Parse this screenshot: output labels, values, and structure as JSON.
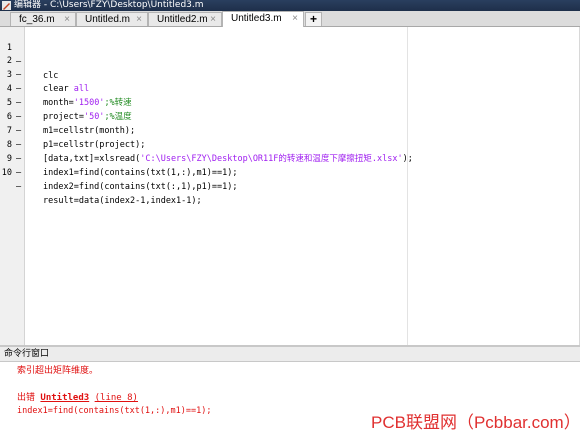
{
  "window": {
    "title": "编辑器 - C:\\Users\\FZY\\Desktop\\Untitled3.m"
  },
  "tabs": [
    {
      "label": "fc_36.m",
      "close": "×"
    },
    {
      "label": "Untitled.m",
      "close": "×"
    },
    {
      "label": "Untitled2.m",
      "close": "×"
    },
    {
      "label": "Untitled3.m",
      "close": "×",
      "active": true
    }
  ],
  "add_tab_label": "+",
  "editor": {
    "lines": [
      {
        "num": "1",
        "dash": "–",
        "code": "clc"
      },
      {
        "num": "2",
        "dash": "–",
        "code": "clear ",
        "str": "all"
      },
      {
        "num": "3",
        "dash": "–",
        "code": "month=",
        "str": "'1500'",
        "cmt": ";%转速"
      },
      {
        "num": "4",
        "dash": "–",
        "code": "project=",
        "str": "'50'",
        "cmt": ";%温度"
      },
      {
        "num": "5",
        "dash": "–",
        "code": "m1=cellstr(month);"
      },
      {
        "num": "6",
        "dash": "–",
        "code": "p1=cellstr(project);"
      },
      {
        "num": "7",
        "dash": "–",
        "code": "[data,txt]=xlsread(",
        "str": "'C:\\Users\\FZY\\Desktop\\OR11F的转速和温度下摩擦扭矩.xlsx'",
        "tail": ");"
      },
      {
        "num": "8",
        "dash": "–",
        "code": "index1=find(contains(txt(1,:),m1)==1);"
      },
      {
        "num": "9",
        "dash": "–",
        "code": "index2=find(contains(txt(:,1),p1)==1);"
      },
      {
        "num": "10",
        "dash": "–",
        "code": "result=data(index2-1,index1-1);"
      }
    ]
  },
  "command_window": {
    "title": "命令行窗口",
    "error_message": "索引超出矩阵维度。",
    "error_prefix": "出错 ",
    "error_file": "Untitled3",
    "error_line": "(line 8)",
    "error_code": "index1=find(contains(txt(1,:),m1)==1);"
  },
  "watermark": "PCB联盟网（Pcbbar.com）",
  "colors": {
    "string": "#a020f0",
    "comment": "#228b22",
    "error": "#e01010",
    "watermark": "#e03030"
  }
}
